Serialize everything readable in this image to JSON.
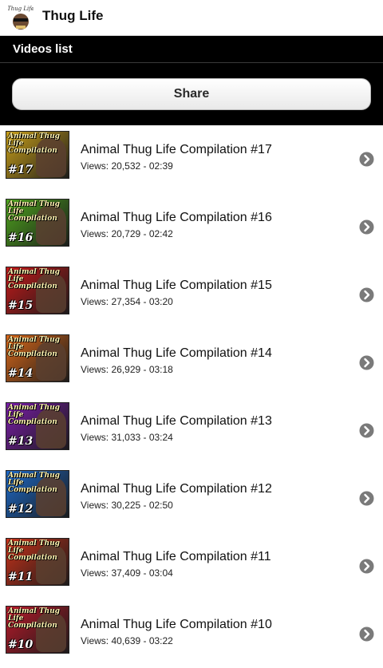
{
  "app": {
    "title": "Thug Life",
    "icon": "thug-life-dog-icon"
  },
  "section": {
    "title": "Videos list"
  },
  "share": {
    "label": "Share"
  },
  "videos": [
    {
      "title": "Animal Thug Life Compilation #17",
      "meta": "Views: 20,532 - 02:39",
      "thumb_caption": "Animal Thug Life Compilation",
      "thumb_number": "#17",
      "thumb_color": "#c9a01a"
    },
    {
      "title": "Animal Thug Life Compilation #16",
      "meta": "Views: 20,729 - 02:42",
      "thumb_caption": "Animal Thug Life Compilation",
      "thumb_number": "#16",
      "thumb_color": "#4fa51e"
    },
    {
      "title": "Animal Thug Life Compilation #15",
      "meta": "Views: 27,354 - 03:20",
      "thumb_caption": "Animal Thug Life Compilation",
      "thumb_number": "#15",
      "thumb_color": "#c41a1a"
    },
    {
      "title": "Animal Thug Life Compilation #14",
      "meta": "Views: 26,929 - 03:18",
      "thumb_caption": "Animal Thug Life Compilation",
      "thumb_number": "#14",
      "thumb_color": "#d8681a"
    },
    {
      "title": "Animal Thug Life Compilation #13",
      "meta": "Views: 31,033 - 03:24",
      "thumb_caption": "Animal Thug Life Compilation",
      "thumb_number": "#13",
      "thumb_color": "#7a1ea8"
    },
    {
      "title": "Animal Thug Life Compilation #12",
      "meta": "Views: 30,225 - 02:50",
      "thumb_caption": "Animal Thug Life Compilation",
      "thumb_number": "#12",
      "thumb_color": "#1e6ac8"
    },
    {
      "title": "Animal Thug Life Compilation #11",
      "meta": "Views: 37,409 - 03:04",
      "thumb_caption": "Animal Thug Life Compilation",
      "thumb_number": "#11",
      "thumb_color": "#c8321a"
    },
    {
      "title": "Animal Thug Life Compilation #10",
      "meta": "Views: 40,639 - 03:22",
      "thumb_caption": "Animal Thug Life Compilation",
      "thumb_number": "#10",
      "thumb_color": "#b81a2a"
    }
  ],
  "icons": {
    "row_chevron": "chevron-right-circle-icon"
  }
}
